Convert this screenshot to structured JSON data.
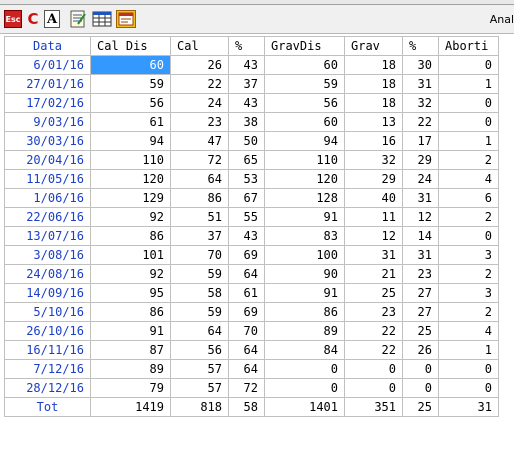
{
  "toolbar": {
    "title": "Anal",
    "buttons": [
      {
        "name": "esc-button",
        "label": "Esc"
      },
      {
        "name": "calc-button",
        "label": "C"
      },
      {
        "name": "font-button",
        "label": "A"
      },
      {
        "name": "notes-button",
        "label": ""
      },
      {
        "name": "table-view-button",
        "label": ""
      },
      {
        "name": "window-button",
        "label": ""
      }
    ]
  },
  "table": {
    "headers": [
      "Data",
      "Cal Dis",
      "Cal",
      "%",
      "GravDis",
      "Grav",
      "%",
      "Aborti"
    ],
    "selected_cell": {
      "row": 0,
      "col": 1
    },
    "rows": [
      [
        "6/01/16",
        "60",
        "26",
        "43",
        "60",
        "18",
        "30",
        "0"
      ],
      [
        "27/01/16",
        "59",
        "22",
        "37",
        "59",
        "18",
        "31",
        "1"
      ],
      [
        "17/02/16",
        "56",
        "24",
        "43",
        "56",
        "18",
        "32",
        "0"
      ],
      [
        "9/03/16",
        "61",
        "23",
        "38",
        "60",
        "13",
        "22",
        "0"
      ],
      [
        "30/03/16",
        "94",
        "47",
        "50",
        "94",
        "16",
        "17",
        "1"
      ],
      [
        "20/04/16",
        "110",
        "72",
        "65",
        "110",
        "32",
        "29",
        "2"
      ],
      [
        "11/05/16",
        "120",
        "64",
        "53",
        "120",
        "29",
        "24",
        "4"
      ],
      [
        "1/06/16",
        "129",
        "86",
        "67",
        "128",
        "40",
        "31",
        "6"
      ],
      [
        "22/06/16",
        "92",
        "51",
        "55",
        "91",
        "11",
        "12",
        "2"
      ],
      [
        "13/07/16",
        "86",
        "37",
        "43",
        "83",
        "12",
        "14",
        "0"
      ],
      [
        "3/08/16",
        "101",
        "70",
        "69",
        "100",
        "31",
        "31",
        "3"
      ],
      [
        "24/08/16",
        "92",
        "59",
        "64",
        "90",
        "21",
        "23",
        "2"
      ],
      [
        "14/09/16",
        "95",
        "58",
        "61",
        "91",
        "25",
        "27",
        "3"
      ],
      [
        "5/10/16",
        "86",
        "59",
        "69",
        "86",
        "23",
        "27",
        "2"
      ],
      [
        "26/10/16",
        "91",
        "64",
        "70",
        "89",
        "22",
        "25",
        "4"
      ],
      [
        "16/11/16",
        "87",
        "56",
        "64",
        "84",
        "22",
        "26",
        "1"
      ],
      [
        "7/12/16",
        "89",
        "57",
        "64",
        "0",
        "0",
        "0",
        "0"
      ],
      [
        "28/12/16",
        "79",
        "57",
        "72",
        "0",
        "0",
        "0",
        "0"
      ]
    ],
    "total": [
      "Tot",
      "1419",
      "818",
      "58",
      "1401",
      "351",
      "25",
      "31"
    ]
  }
}
